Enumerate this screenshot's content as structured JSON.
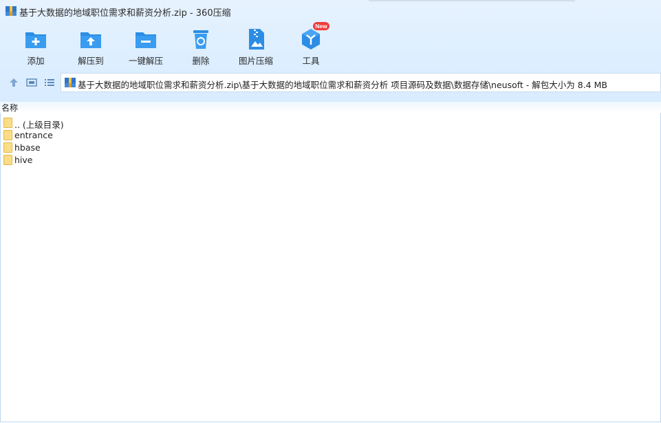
{
  "window": {
    "title": "基于大数据的地域职位需求和薪资分析.zip - 360压缩"
  },
  "toolbar": {
    "buttons": [
      {
        "label": "添加",
        "icon": "folder-add-icon"
      },
      {
        "label": "解压到",
        "icon": "folder-extract-icon"
      },
      {
        "label": "一键解压",
        "icon": "folder-oneclick-extract-icon"
      },
      {
        "label": "删除",
        "icon": "trash-icon"
      },
      {
        "label": "图片压缩",
        "icon": "image-compress-icon"
      },
      {
        "label": "工具",
        "icon": "tools-cube-icon"
      }
    ],
    "new_badge": "New"
  },
  "navigation": {
    "address_path": "基于大数据的地域职位需求和薪资分析.zip\\基于大数据的地域职位需求和薪资分析 项目源码及数据\\数据存储\\neusoft - 解包大小为 8.4 MB"
  },
  "file_list": {
    "column_header": "名称",
    "items": [
      {
        "name": ".. (上级目录)"
      },
      {
        "name": "entrance"
      },
      {
        "name": "hbase"
      },
      {
        "name": "hive"
      }
    ]
  },
  "colors": {
    "accent": "#2c8de4",
    "toolbar_bg": "#dceeff",
    "folder": "#fbdd87",
    "badge": "#f03c3c"
  }
}
